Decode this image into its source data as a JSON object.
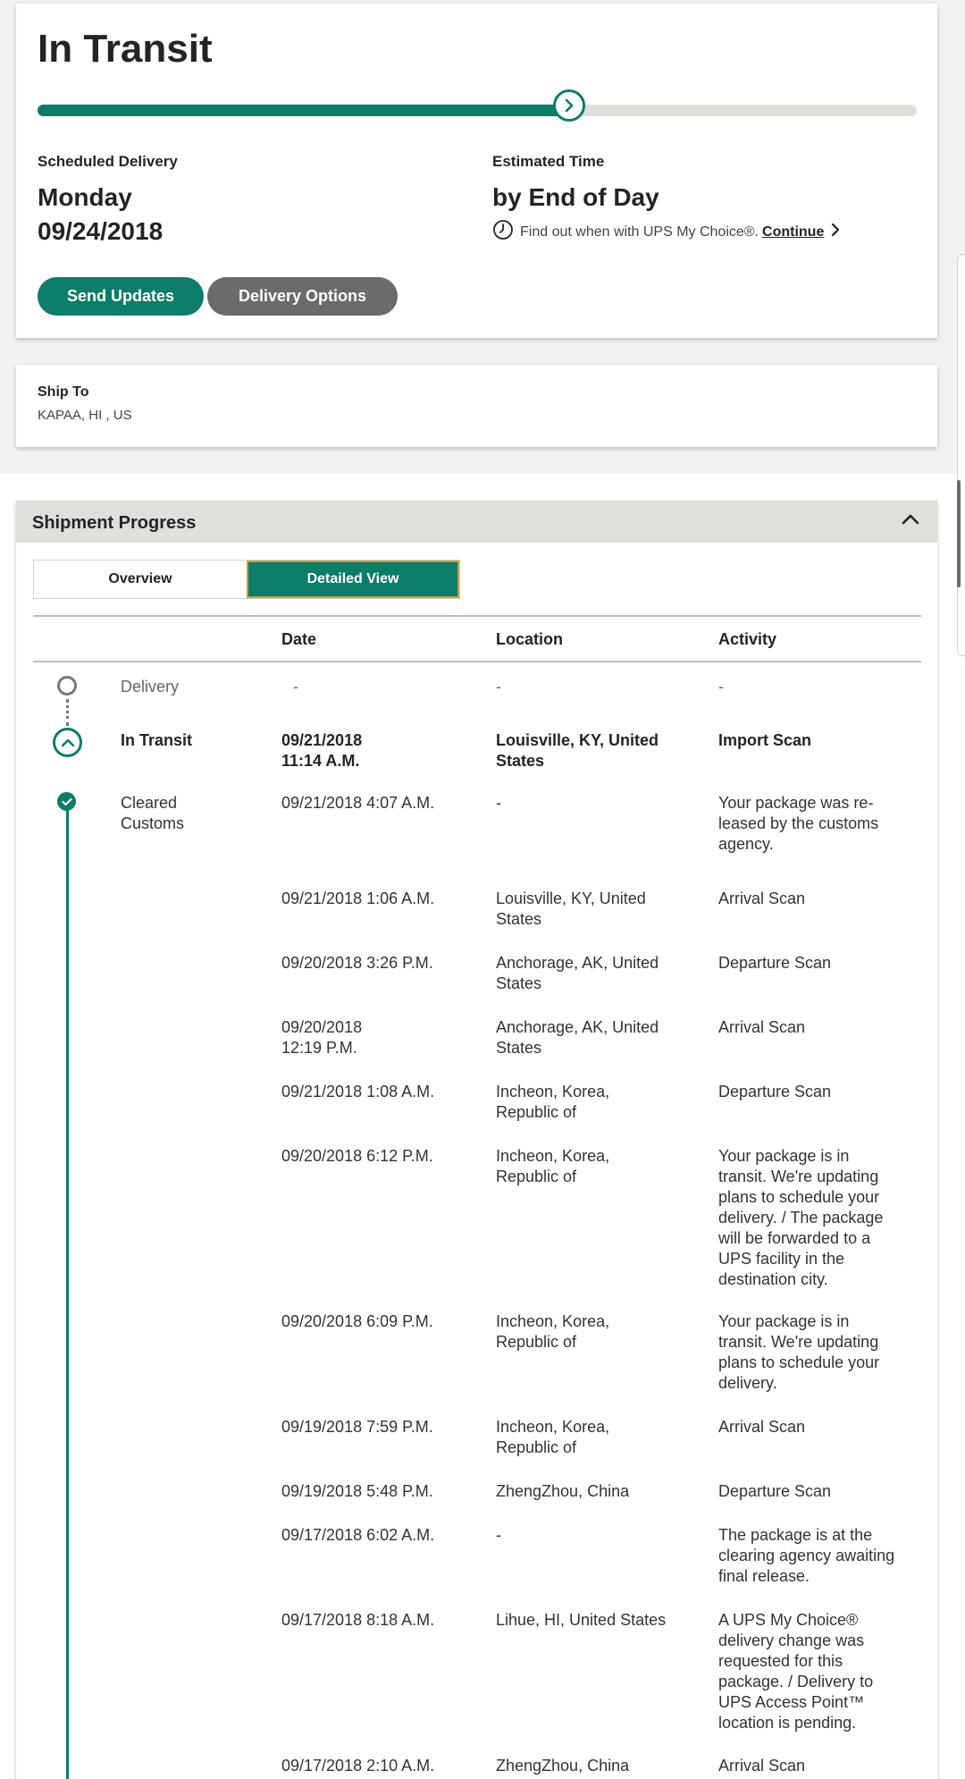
{
  "status": {
    "title": "In Transit",
    "progress_fraction": 0.605
  },
  "delivery": {
    "scheduled_label": "Scheduled Delivery",
    "scheduled_day": "Monday",
    "scheduled_date": "09/24/2018",
    "estimated_label": "Estimated Time",
    "estimated_value": "by End of Day",
    "find_out_text": "Find out when with UPS My Choice®.",
    "continue_label": "Continue"
  },
  "buttons": {
    "send_updates": "Send Updates",
    "delivery_options": "Delivery Options"
  },
  "ship_to": {
    "label": "Ship To",
    "value": "KAPAA, HI , US"
  },
  "shipment_progress": {
    "title": "Shipment Progress",
    "tabs": [
      {
        "label": "Overview",
        "active": false
      },
      {
        "label": "Detailed View",
        "active": true
      }
    ],
    "columns": [
      "Date",
      "Location",
      "Activity"
    ],
    "milestones": [
      {
        "status": "Delivery",
        "date": "-",
        "location": "-",
        "activity": "-"
      },
      {
        "status": "In Transit",
        "date": "09/21/2018 11:14 A.M.",
        "location": "Louisville, KY, United States",
        "activity": "Import Scan"
      },
      {
        "status": "Cleared Customs",
        "date": "09/21/2018  4:07 A.M.",
        "location": "-",
        "activity": "Your package was re-leased by the customs agency."
      }
    ],
    "events": [
      {
        "date": "09/21/2018  1:06 A.M.",
        "location": "Louisville, KY, United States",
        "activity": "Arrival Scan"
      },
      {
        "date": "09/20/2018  3:26 P.M.",
        "location": "Anchorage, AK, United States",
        "activity": "Departure Scan"
      },
      {
        "date": "09/20/2018 12:19 P.M.",
        "location": "Anchorage, AK, United States",
        "activity": "Arrival Scan"
      },
      {
        "date": "09/21/2018  1:08 A.M.",
        "location": "Incheon, Korea, Republic of",
        "activity": "Departure Scan"
      },
      {
        "date": "09/20/2018  6:12 P.M.",
        "location": "Incheon, Korea, Republic of",
        "activity": "Your package is in transit. We're updating plans to schedule your delivery. / The package will be forwarded to a UPS facility in the destination city."
      },
      {
        "date": "09/20/2018  6:09 P.M.",
        "location": "Incheon, Korea, Republic of",
        "activity": "Your package is in transit. We're updating plans to schedule your delivery."
      },
      {
        "date": "09/19/2018  7:59 P.M.",
        "location": "Incheon, Korea, Republic of",
        "activity": "Arrival Scan"
      },
      {
        "date": "09/19/2018  5:48 P.M.",
        "location": "ZhengZhou, China",
        "activity": "Departure Scan"
      },
      {
        "date": "09/17/2018  6:02 A.M.",
        "location": "-",
        "activity": "The package is at the clearing agency awaiting final release."
      },
      {
        "date": "09/17/2018  8:18 A.M.",
        "location": "Lihue, HI, United States",
        "activity": "A UPS My Choice® delivery change was requested for this package. / Delivery to UPS Access Point™ location is pending."
      },
      {
        "date": "09/17/2018  2:10 A.M.",
        "location": "ZhengZhou, China",
        "activity": "Arrival Scan"
      }
    ]
  },
  "colors": {
    "brand_green": "#0b7d68",
    "button_gray": "#6b6b6b",
    "header_gray": "#dfdfdb"
  }
}
